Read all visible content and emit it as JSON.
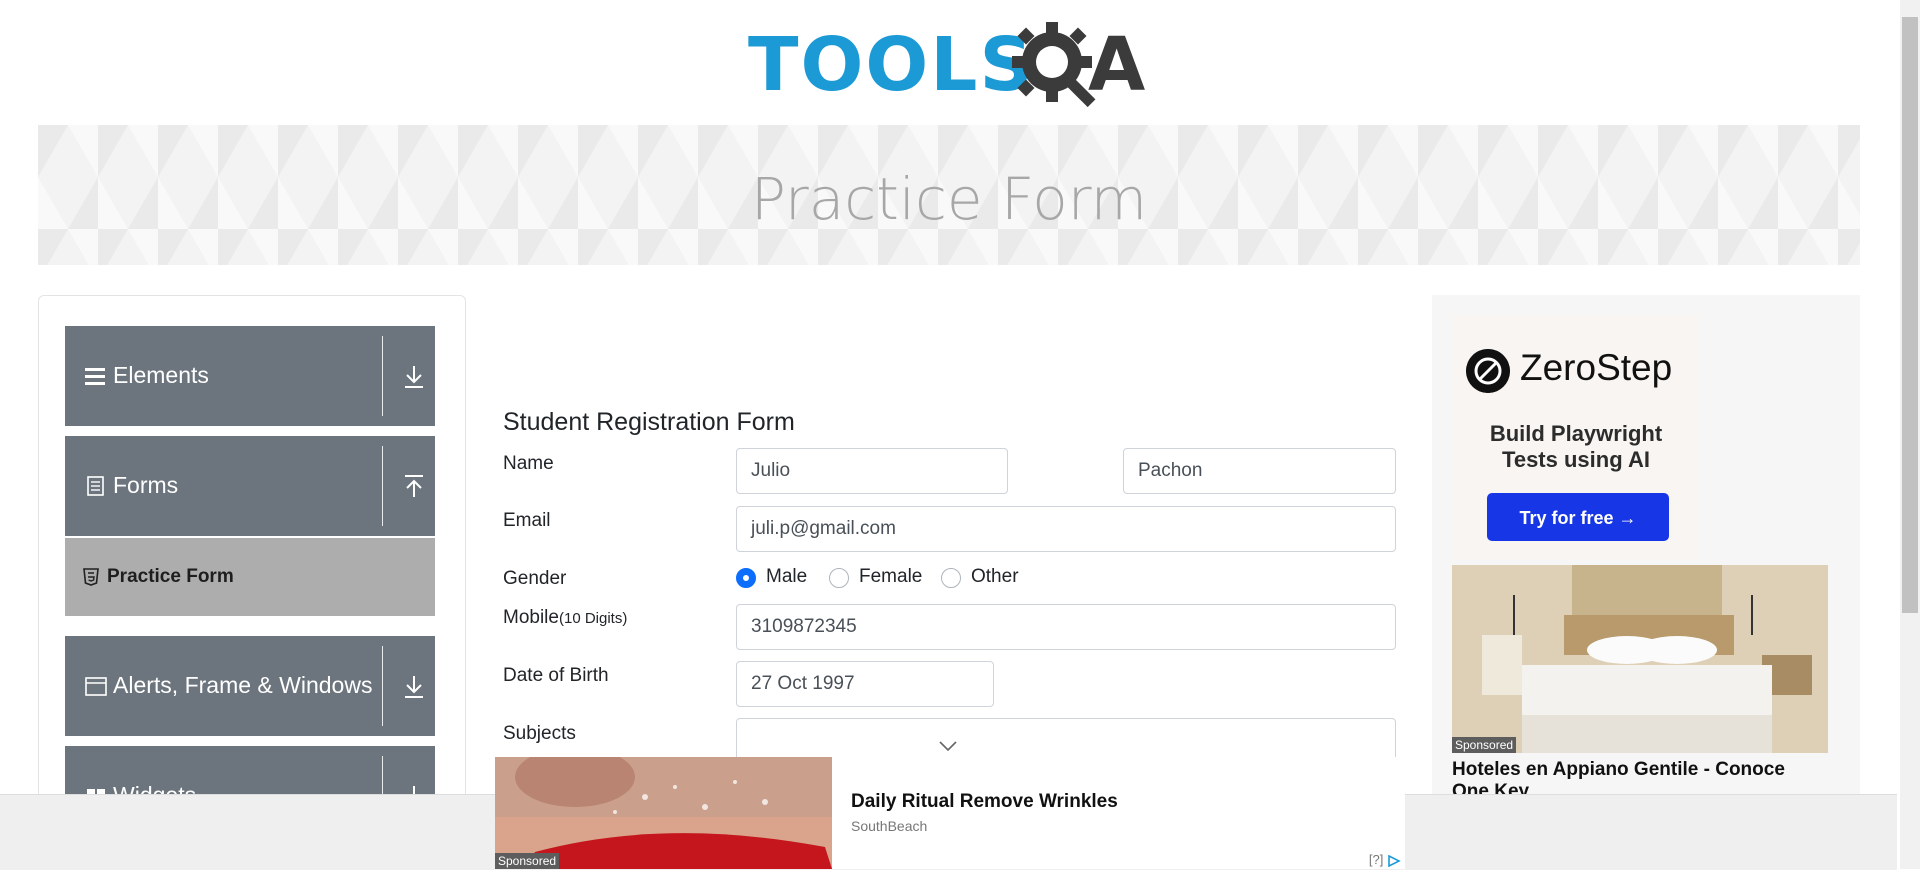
{
  "logo": {
    "text_blue": "TOOLS",
    "text_dark": "A",
    "alt": "TOOLSQA"
  },
  "banner": {
    "title": "Practice Form"
  },
  "sidebar": {
    "groups": [
      {
        "label": "Elements",
        "icon": "list-icon",
        "toggle": "download-icon"
      },
      {
        "label": "Forms",
        "icon": "document-icon",
        "toggle": "upload-icon"
      },
      {
        "label": "Alerts, Frame & Windows",
        "icon": "window-icon",
        "toggle": "download-icon"
      },
      {
        "label": "Widgets",
        "icon": "widgets-icon",
        "toggle": "download-icon"
      }
    ],
    "active_item": {
      "label": "Practice Form",
      "icon": "html5-icon"
    }
  },
  "form": {
    "title": "Student Registration Form",
    "name_label": "Name",
    "first_name": "Julio",
    "last_name": "Pachon",
    "email_label": "Email",
    "email": "juli.p@gmail.com",
    "gender_label": "Gender",
    "gender_options": [
      "Male",
      "Female",
      "Other"
    ],
    "gender_selected": "Male",
    "mobile_label": "Mobile",
    "mobile_hint": "(10 Digits)",
    "mobile": "3109872345",
    "dob_label": "Date of Birth",
    "dob": "27 Oct 1997",
    "subjects_label": "Subjects",
    "subjects": ""
  },
  "right_ad": {
    "brand": "ZeroStep",
    "tagline_line1": "Build Playwright",
    "tagline_line2": "Tests using AI",
    "cta": "Try for free →",
    "sponsored": "Sponsored",
    "headline_line1": "Hoteles en Appiano Gentile - Conoce",
    "headline_line2": "One Key"
  },
  "bottom_ad": {
    "title": "Daily Ritual Remove Wrinkles",
    "brand": "SouthBeach",
    "sponsored": "Sponsored",
    "info": "[?]"
  },
  "colors": {
    "sidebar_header": "#6c757d",
    "active_item": "#adadad",
    "radio_checked": "#0d6efd",
    "cta": "#1736e6",
    "logo_blue": "#1c9ad6",
    "logo_dark": "#3b3b3b"
  }
}
